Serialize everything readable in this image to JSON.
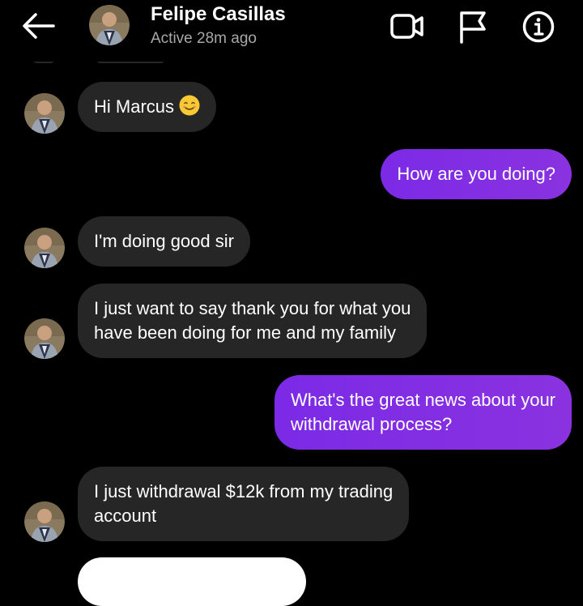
{
  "header": {
    "contact_name": "Felipe Casillas",
    "status": "Active 28m ago",
    "icons": [
      "back-arrow-icon",
      "video-call-icon",
      "flag-icon",
      "info-icon"
    ]
  },
  "messages": [
    {
      "direction": "incoming",
      "lines": [
        "Hi Marcus"
      ],
      "emoji": "smiling-face"
    },
    {
      "direction": "outgoing",
      "lines": [
        "How are you doing?"
      ]
    },
    {
      "direction": "incoming",
      "lines": [
        "I'm doing good sir"
      ]
    },
    {
      "direction": "incoming",
      "lines": [
        "I just want to say thank you for what you",
        "have been doing for me and my family"
      ]
    },
    {
      "direction": "outgoing",
      "lines": [
        "What's the great news about your",
        "withdrawal process?"
      ]
    },
    {
      "direction": "incoming",
      "lines": [
        "I just withdrawal $12k from my trading",
        "account"
      ]
    }
  ],
  "colors": {
    "background": "#000000",
    "incoming_bubble": "#262626",
    "outgoing_bubble": "#8a32e0",
    "status_text": "#a8a8a8"
  }
}
